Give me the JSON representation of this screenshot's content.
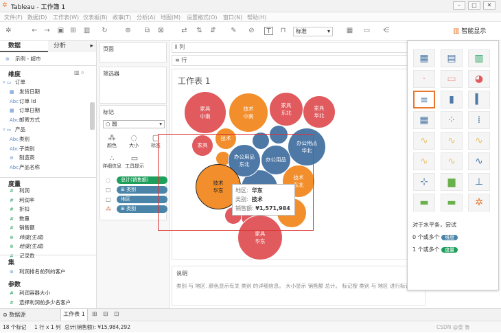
{
  "window": {
    "title": "Tableau - 工作簿 1"
  },
  "menu": [
    "文件(F)",
    "数据(D)",
    "工作表(W)",
    "仪表板(B)",
    "故事(T)",
    "分析(A)",
    "地图(M)",
    "设置格式(O)",
    "窗口(N)",
    "帮助(H)"
  ],
  "toolbar": {
    "fit": "标准",
    "smart_label": "智能显示"
  },
  "left": {
    "tab_data": "数据",
    "tab_analysis": "分析",
    "datasource": "示例 - 超市",
    "dims_header": "维度",
    "dims": [
      {
        "label": "订单",
        "icon": "folder-icon",
        "group": true
      },
      {
        "label": "发货日期",
        "icon": "calendar-icon"
      },
      {
        "label": "订单 Id",
        "icon": "abc-icon"
      },
      {
        "label": "订单日期",
        "icon": "calendar-icon"
      },
      {
        "label": "邮寄方式",
        "icon": "abc-icon"
      },
      {
        "label": "产品",
        "icon": "folder-icon",
        "group": true
      },
      {
        "label": "类别",
        "icon": "abc-icon"
      },
      {
        "label": "子类别",
        "icon": "abc-icon"
      },
      {
        "label": "制造商",
        "icon": "link-icon"
      },
      {
        "label": "产品名称",
        "icon": "abc-icon"
      }
    ],
    "meas_header": "度量",
    "measures": [
      "利润",
      "利润率",
      "折扣",
      "数量",
      "销售额",
      "纬度(生成)",
      "经度(生成)",
      "记录数"
    ],
    "sets_header": "集",
    "sets": [
      "利润排名前列的客户"
    ],
    "params_header": "参数",
    "params": [
      "利润容器大小",
      "选择利润前多少名客户"
    ]
  },
  "shelves": {
    "pages": "页面",
    "filters": "筛选器",
    "marks": "标记",
    "mark_type": "圆",
    "mark_buttons": [
      "颜色",
      "大小",
      "标签",
      "详细信息",
      "工具提示"
    ],
    "mark_pills": [
      {
        "label": "总计(销售额)",
        "kind": "measure"
      },
      {
        "label": "类别",
        "kind": "dimension"
      },
      {
        "label": "地区",
        "kind": "dimension"
      },
      {
        "label": "类别",
        "kind": "dimension"
      }
    ],
    "columns": "列",
    "rows": "行"
  },
  "sheet": {
    "title": "工作表 1"
  },
  "bubbles": [
    {
      "cat": "家具",
      "region": "中南",
      "color": "#e05a5e"
    },
    {
      "cat": "技术",
      "region": "中南",
      "color": "#f28e2b"
    },
    {
      "cat": "家具",
      "region": "东北",
      "color": "#e05a5e"
    },
    {
      "cat": "家具",
      "region": "华北",
      "color": "#e05a5e"
    },
    {
      "cat": "技术",
      "region": "",
      "color": "#f28e2b"
    },
    {
      "cat": "家具",
      "region": "",
      "color": "#e05a5e"
    },
    {
      "cat": "办公用品",
      "region": "华北",
      "color": "#4e79a7"
    },
    {
      "cat": "办公用品",
      "region": "东北",
      "color": "#4e79a7"
    },
    {
      "cat": "办公用品",
      "region": "",
      "color": "#4e79a7"
    },
    {
      "cat": "技术",
      "region": "华东",
      "color": "#f28e2b"
    },
    {
      "cat": "技术",
      "region": "东北",
      "color": "#f28e2b"
    },
    {
      "cat": "家具",
      "region": "华东",
      "color": "#e05a5e"
    }
  ],
  "tooltip": {
    "region_label": "地区:",
    "region": "华东",
    "cat_label": "类别:",
    "cat": "技术",
    "sales_label": "销售额:",
    "sales": "¥1,571,984"
  },
  "description": {
    "title": "说明",
    "text": "类别 与 地区. 颜色显示有关 类别 的详细信息。 大小显示 销售额 总计。 标记按 类别 与 地区 进行标记。"
  },
  "smart": {
    "hint": "对于水平条，尝试",
    "dims_req": "0 个或多个",
    "dims_badge": "维度",
    "meas_req": "1 个或多个",
    "meas_badge": "度量"
  },
  "tabs": {
    "datasource": "数据源",
    "sheet": "工作表 1"
  },
  "status": {
    "marks": "18 个标记",
    "rows": "1 行 x 1 列",
    "sum": "总计(销售额): ¥15,984,292"
  },
  "watermark": "CSDN @皇 鲁"
}
